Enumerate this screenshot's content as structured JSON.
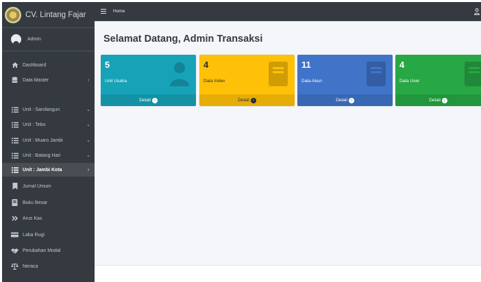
{
  "brand": {
    "name": "CV. Lintang Fajar"
  },
  "user_panel": {
    "name": "Admin"
  },
  "topbar": {
    "home_label": "Home",
    "menu_icon": "hamburger-icon",
    "user_icon": "user-icon"
  },
  "sidebar": {
    "items": [
      {
        "label": "Dashboard",
        "icon": "home-icon",
        "arrow": ""
      },
      {
        "label": "Data Master",
        "icon": "database-icon",
        "arrow": "‹"
      },
      {
        "label": "Unit : Sarolangun",
        "icon": "list-icon",
        "arrow": "⌄"
      },
      {
        "label": "Unit : Tebo",
        "icon": "list-icon",
        "arrow": "⌄"
      },
      {
        "label": "Unit : Muaro Jambi",
        "icon": "list-icon",
        "arrow": "⌄"
      },
      {
        "label": "Unit : Batang Hari",
        "icon": "list-icon",
        "arrow": "⌄"
      },
      {
        "label": "Unit : Jambi Kota",
        "icon": "list-icon",
        "arrow": "›",
        "active": true
      },
      {
        "label": "Jurnal Umum",
        "icon": "bookmark-icon",
        "arrow": ""
      },
      {
        "label": "Buku Besar",
        "icon": "book-icon",
        "arrow": ""
      },
      {
        "label": "Arus Kas",
        "icon": "double-chevron-icon",
        "arrow": ""
      },
      {
        "label": "Laba Rugi",
        "icon": "money-icon",
        "arrow": ""
      },
      {
        "label": "Perubahan Modal",
        "icon": "handshake-icon",
        "arrow": ""
      },
      {
        "label": "Neraca",
        "icon": "balance-icon",
        "arrow": ""
      }
    ]
  },
  "page": {
    "title": "Selamat Datang, Admin Transaksi"
  },
  "boxes": [
    {
      "value": "5",
      "label": "Unit Usaha",
      "footer": "Detail",
      "color": "#17a2b8",
      "icon": "user-icon"
    },
    {
      "value": "4",
      "label": "Data Index",
      "footer": "Detail",
      "color": "#ffc107",
      "icon": "book-icon"
    },
    {
      "value": "11",
      "label": "Data Akun",
      "footer": "Detail",
      "color": "#3f74c8",
      "icon": "book-icon"
    },
    {
      "value": "4",
      "label": "Data User",
      "footer": "Detail",
      "color": "#28a745",
      "icon": "book-icon"
    }
  ]
}
